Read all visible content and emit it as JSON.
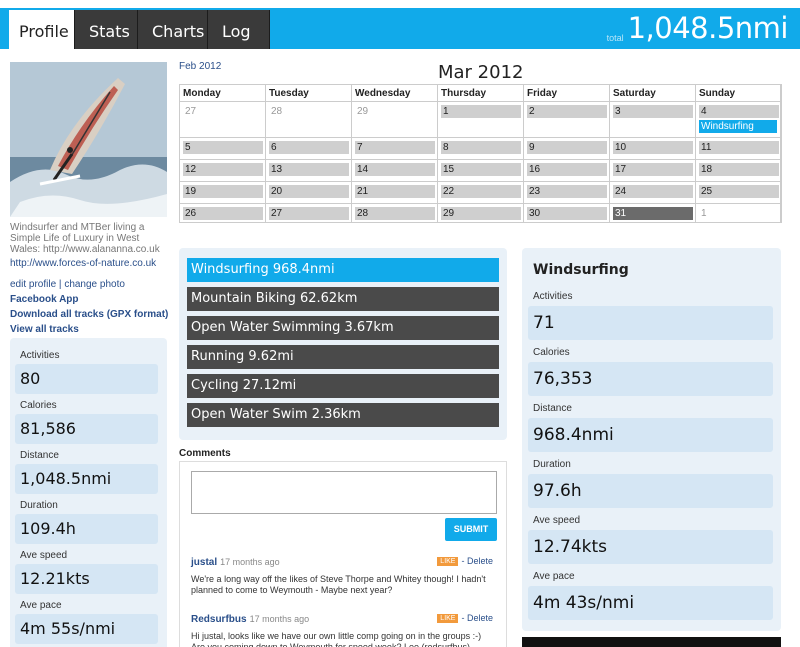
{
  "tabs": [
    {
      "label": "Profile",
      "active": true
    },
    {
      "label": "Stats",
      "active": false
    },
    {
      "label": "Charts",
      "active": false
    },
    {
      "label": "Log",
      "active": false
    }
  ],
  "total": {
    "label": "total",
    "value": "1,048.5nmi"
  },
  "profile": {
    "bio": "Windsurfer and MTBer living a Simple Life of Luxury in West Wales: http://www.alananna.co.uk",
    "website": "http://www.forces-of-nature.co.uk",
    "edit_profile": "edit profile",
    "separator": "|",
    "change_photo": "change photo",
    "facebook_app": "Facebook App",
    "download_tracks": "Download all tracks (GPX format)",
    "view_tracks": "View all tracks"
  },
  "left_stats": [
    {
      "label": "Activities",
      "value": "80"
    },
    {
      "label": "Calories",
      "value": "81,586"
    },
    {
      "label": "Distance",
      "value": "1,048.5nmi"
    },
    {
      "label": "Duration",
      "value": "109.4h"
    },
    {
      "label": "Ave speed",
      "value": "12.21kts"
    },
    {
      "label": "Ave pace",
      "value": "4m 55s/nmi"
    }
  ],
  "calendar": {
    "prev_month": "Feb 2012",
    "title": "Mar 2012",
    "weekdays": [
      "Monday",
      "Tuesday",
      "Wednesday",
      "Thursday",
      "Friday",
      "Saturday",
      "Sunday"
    ],
    "weeks": [
      [
        "27",
        "28",
        "29",
        "1",
        "2",
        "3",
        "4"
      ],
      [
        "5",
        "6",
        "7",
        "8",
        "9",
        "10",
        "11"
      ],
      [
        "12",
        "13",
        "14",
        "15",
        "16",
        "17",
        "18"
      ],
      [
        "19",
        "20",
        "21",
        "22",
        "23",
        "24",
        "25"
      ],
      [
        "26",
        "27",
        "28",
        "29",
        "30",
        "31",
        "1"
      ]
    ],
    "event": {
      "label": "Windsurfing"
    },
    "colors": {
      "day": "#cfcfcf",
      "today": "#6b6b6b",
      "event": "#11aaea"
    }
  },
  "sports": [
    {
      "label": "Windsurfing 968.4nmi",
      "active": true
    },
    {
      "label": "Mountain Biking 62.62km",
      "active": false
    },
    {
      "label": "Open Water Swimming 3.67km",
      "active": false
    },
    {
      "label": "Running 9.62mi",
      "active": false
    },
    {
      "label": "Cycling 27.12mi",
      "active": false
    },
    {
      "label": "Open Water Swim 2.36km",
      "active": false
    }
  ],
  "comments": {
    "heading": "Comments",
    "submit_label": "SUBMIT",
    "items": [
      {
        "user": "justal",
        "ago": "17 months ago",
        "like": "LIKE",
        "delete": "- Delete",
        "body": "We're a long way off the likes of Steve Thorpe and Whitey though! I hadn't planned to come to Weymouth - Maybe next year?"
      },
      {
        "user": "Redsurfbus",
        "ago": "17 months ago",
        "like": "LIKE",
        "delete": "- Delete",
        "body": "Hi justal, looks like we have our own little comp going on in the groups :-) Are you coming down to Weymouth for speed week? Lee (redsurfbus)"
      }
    ]
  },
  "sport_stats": {
    "title": "Windsurfing",
    "items": [
      {
        "label": "Activities",
        "value": "71"
      },
      {
        "label": "Calories",
        "value": "76,353"
      },
      {
        "label": "Distance",
        "value": "968.4nmi"
      },
      {
        "label": "Duration",
        "value": "97.6h"
      },
      {
        "label": "Ave speed",
        "value": "12.74kts"
      },
      {
        "label": "Ave pace",
        "value": "4m 43s/nmi"
      }
    ]
  },
  "colors": {
    "accent": "#11aaea",
    "panel": "#e9f1f8",
    "stat_box": "#d5e6f4",
    "dark_tab": "#3a3a3a"
  }
}
